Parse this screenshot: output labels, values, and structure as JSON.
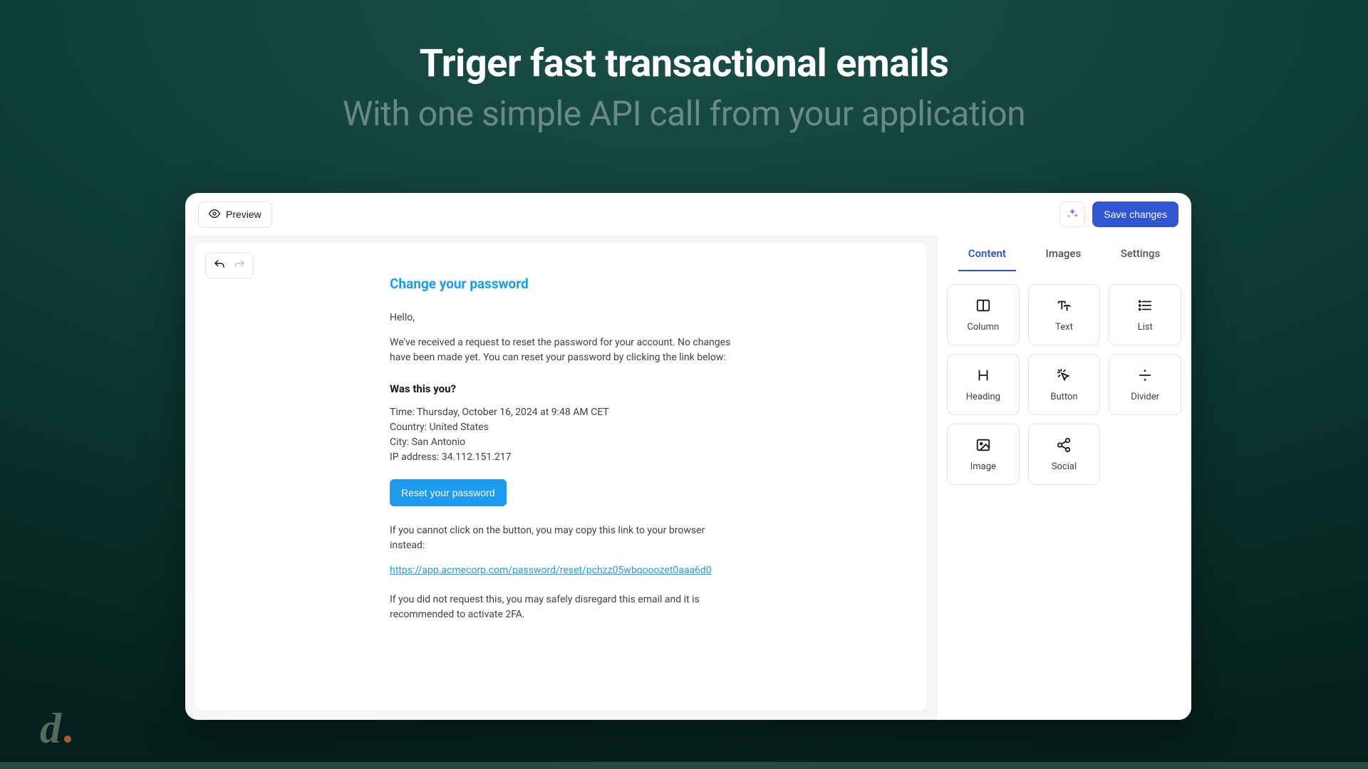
{
  "hero": {
    "title": "Triger fast transactional emails",
    "subtitle": "With one simple API call from your application"
  },
  "topbar": {
    "preview_label": "Preview",
    "save_label": "Save changes"
  },
  "email": {
    "title": "Change your password",
    "greeting": "Hello,",
    "intro": "We've received a request to reset the password for your account. No changes have been made yet. You can reset your password by clicking the link below:",
    "was_this_you": "Was this you?",
    "meta": {
      "time": "Time: Thursday, October 16, 2024 at 9:48 AM CET",
      "country": "Country: United States",
      "city": "City: San Antonio",
      "ip": "IP address: 34.112.151.217"
    },
    "reset_button": "Reset your password",
    "fallback_text": "If you cannot click on the button, you may copy this link to your browser instead:",
    "reset_link": "https://app.acmecorp.com/password/reset/pchzz05wbqooozet0aaa6d0",
    "disclaimer": "If you did not request this, you may safely disregard this email and it is recommended to activate 2FA."
  },
  "sidebar": {
    "tabs": {
      "content": "Content",
      "images": "Images",
      "settings": "Settings"
    },
    "blocks": {
      "column": "Column",
      "text": "Text",
      "list": "List",
      "heading": "Heading",
      "button": "Button",
      "divider": "Divider",
      "image": "Image",
      "social": "Social"
    }
  },
  "logo": {
    "letter": "d"
  }
}
